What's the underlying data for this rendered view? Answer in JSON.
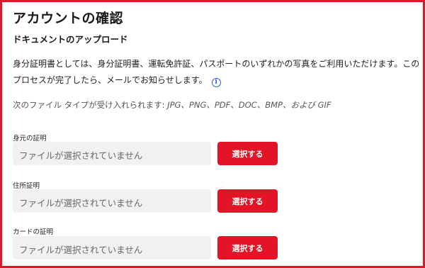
{
  "page": {
    "title": "アカウントの確認",
    "section_title": "ドキュメントのアップロード",
    "description": "身分証明書としては、身分証明書、運転免許証、パスポートのいずれかの写真をご利用いただけます。このプロセスが完了したら、メールでお知らせします。",
    "formats_prefix": "次のファイル タイプが受け入れられます: ",
    "formats_list": "JPG、PNG、PDF、DOC、BMP、および GIF",
    "info_icon": "info-icon",
    "accent_color": "#e41427",
    "frame_color": "#e0162b",
    "info_color": "#2a64c9"
  },
  "fields": [
    {
      "label": "身元の証明",
      "placeholder": "ファイルが選択されていません",
      "button": "選択する"
    },
    {
      "label": "住所証明",
      "placeholder": "ファイルが選択されていません",
      "button": "選択する"
    },
    {
      "label": "カードの証明",
      "placeholder": "ファイルが選択されていません",
      "button": "選択する"
    }
  ]
}
